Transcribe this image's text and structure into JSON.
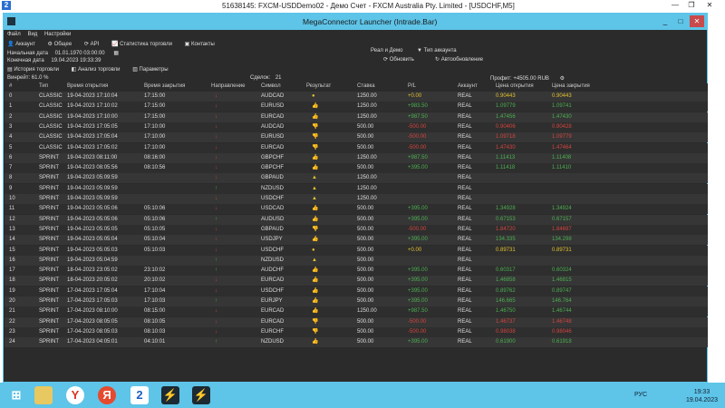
{
  "outer_title": "51638145: FXCM-USDDemo02 - Демо Счет - FXCM Australia Pty. Limited - [USDCHF,M5]",
  "window_title": "MegaConnector Launcher (Intrade.Bar)",
  "menu": [
    "Файл",
    "Вид",
    "Настройки"
  ],
  "toolbar": [
    "Аккаунт",
    "Общее",
    "API",
    "Статистика торговли",
    "Контакты"
  ],
  "start_date_label": "Начальная дата",
  "start_date": "01.01.1970 03:00:00",
  "end_date_label": "Конечная дата",
  "end_date": "19.04.2023 19:33:39",
  "account_mode": "Реал и Демо",
  "account_type_label": "Тип аккаунта",
  "refresh_label": "Обновить",
  "auto_refresh_label": "Автообновление",
  "tabs": [
    "История торговли",
    "Анализ торговли",
    "Параметры"
  ],
  "winrate": "Винрейт: 61.0 %",
  "deals_label": "Сделок:",
  "deals": "21",
  "profit_label": "Профит:",
  "profit": "+4505.00 RUB",
  "columns": [
    "#",
    "Тип",
    "Время открытия",
    "Время закрытия",
    "Направление",
    "Символ",
    "Результат",
    "Ставка",
    "P/L",
    "Аккаунт",
    "Цена открытия",
    "Цена закрытия"
  ],
  "colors": {
    "win": "#4caf50",
    "loss": "#d2453f",
    "draw": "#e0c030",
    "accent": "#5ec4e8"
  },
  "rows": [
    [
      "0",
      "CLASSIC",
      "19-04-2023 17:10:04",
      "17:15:00",
      "down",
      "AUDCAD",
      "draw",
      "1250.00",
      "+0.00",
      "REAL",
      "0.90443",
      "0.90443"
    ],
    [
      "1",
      "CLASSIC",
      "19-04-2023 17:10:02",
      "17:15:00",
      "down",
      "EURUSD",
      "win",
      "1250.00",
      "+983.50",
      "REAL",
      "1.09779",
      "1.09741"
    ],
    [
      "2",
      "CLASSIC",
      "19-04-2023 17:10:00",
      "17:15:00",
      "down",
      "EURCAD",
      "win",
      "1250.00",
      "+987.50",
      "REAL",
      "1.47456",
      "1.47430"
    ],
    [
      "3",
      "CLASSIC",
      "19-04-2023 17:05:05",
      "17:10:00",
      "down",
      "AUDCAD",
      "loss",
      "500.00",
      "-500.00",
      "REAL",
      "0.90406",
      "0.90428"
    ],
    [
      "4",
      "CLASSIC",
      "19-04-2023 17:05:04",
      "17:10:00",
      "down",
      "EURUSD",
      "loss",
      "500.00",
      "-500.00",
      "REAL",
      "1.09718",
      "1.09779"
    ],
    [
      "5",
      "CLASSIC",
      "19-04-2023 17:05:02",
      "17:10:00",
      "down",
      "EURCAD",
      "loss",
      "500.00",
      "-500.00",
      "REAL",
      "1.47430",
      "1.47464"
    ],
    [
      "6",
      "SPRINT",
      "19-04-2023 08:11:00",
      "08:16:00",
      "down",
      "GBPCHF",
      "win",
      "1250.00",
      "+987.50",
      "REAL",
      "1.11413",
      "1.11408"
    ],
    [
      "7",
      "SPRINT",
      "19-04-2023 08:05:56",
      "08:10:56",
      "down",
      "GBPCHF",
      "win",
      "500.00",
      "+395.00",
      "REAL",
      "1.11418",
      "1.11410"
    ],
    [
      "8",
      "SPRINT",
      "19-04-2023 05:09:59",
      "",
      "down",
      "GBPAUD",
      "pending",
      "1250.00",
      "",
      "REAL",
      "",
      ""
    ],
    [
      "9",
      "SPRINT",
      "19-04-2023 05:09:59",
      "",
      "up",
      "NZDUSD",
      "pending",
      "1250.00",
      "",
      "REAL",
      "",
      ""
    ],
    [
      "10",
      "SPRINT",
      "19-04-2023 05:09:59",
      "",
      "down",
      "USDCHF",
      "pending",
      "1250.00",
      "",
      "REAL",
      "",
      ""
    ],
    [
      "11",
      "SPRINT",
      "19-04-2023 05:05:06",
      "05:10:06",
      "down",
      "USDCAD",
      "win",
      "500.00",
      "+395.00",
      "REAL",
      "1.34928",
      "1.34924"
    ],
    [
      "12",
      "SPRINT",
      "19-04-2023 05:05:06",
      "05:10:06",
      "up",
      "AUDUSD",
      "win",
      "500.00",
      "+395.00",
      "REAL",
      "0.67153",
      "0.67157"
    ],
    [
      "13",
      "SPRINT",
      "19-04-2023 05:05:05",
      "05:10:05",
      "down",
      "GBPAUD",
      "loss",
      "500.00",
      "-500.00",
      "REAL",
      "1.84720",
      "1.84697"
    ],
    [
      "14",
      "SPRINT",
      "19-04-2023 05:05:04",
      "05:10:04",
      "down",
      "USDJPY",
      "win",
      "500.00",
      "+395.00",
      "REAL",
      "134.335",
      "134.298"
    ],
    [
      "15",
      "SPRINT",
      "19-04-2023 05:05:03",
      "05:10:03",
      "down",
      "USDCHF",
      "draw",
      "500.00",
      "+0.00",
      "REAL",
      "0.89731",
      "0.89731"
    ],
    [
      "16",
      "SPRINT",
      "19-04-2023 05:04:59",
      "",
      "up",
      "NZDUSD",
      "pending",
      "500.00",
      "",
      "REAL",
      "",
      ""
    ],
    [
      "17",
      "SPRINT",
      "18-04-2023 23:05:02",
      "23:10:02",
      "up",
      "AUDCHF",
      "win",
      "500.00",
      "+395.00",
      "REAL",
      "0.60317",
      "0.60324"
    ],
    [
      "18",
      "SPRINT",
      "18-04-2023 20:05:02",
      "20:10:02",
      "down",
      "EURCAD",
      "win",
      "500.00",
      "+395.00",
      "REAL",
      "1.46858",
      "1.46815"
    ],
    [
      "19",
      "SPRINT",
      "17-04-2023 17:05:04",
      "17:10:04",
      "down",
      "USDCHF",
      "win",
      "500.00",
      "+395.00",
      "REAL",
      "0.89762",
      "0.89747"
    ],
    [
      "20",
      "SPRINT",
      "17-04-2023 17:05:03",
      "17:10:03",
      "up",
      "EURJPY",
      "win",
      "500.00",
      "+395.00",
      "REAL",
      "146.665",
      "146.764"
    ],
    [
      "21",
      "SPRINT",
      "17-04-2023 08:10:00",
      "08:15:00",
      "down",
      "EURCAD",
      "win",
      "1250.00",
      "+987.50",
      "REAL",
      "1.46750",
      "1.46744"
    ],
    [
      "22",
      "SPRINT",
      "17-04-2023 08:05:05",
      "08:10:05",
      "down",
      "EURCAD",
      "loss",
      "500.00",
      "-500.00",
      "REAL",
      "1.46737",
      "1.46748"
    ],
    [
      "23",
      "SPRINT",
      "17-04-2023 08:05:03",
      "08:10:03",
      "down",
      "EURCHF",
      "loss",
      "500.00",
      "-500.00",
      "REAL",
      "0.98038",
      "0.98046"
    ],
    [
      "24",
      "SPRINT",
      "17-04-2023 04:05:01",
      "04:10:01",
      "up",
      "NZDUSD",
      "win",
      "500.00",
      "+395.00",
      "REAL",
      "0.61900",
      "0.61918"
    ]
  ],
  "tray": {
    "lang": "РУС",
    "time": "19:33",
    "date": "19.04.2023"
  }
}
